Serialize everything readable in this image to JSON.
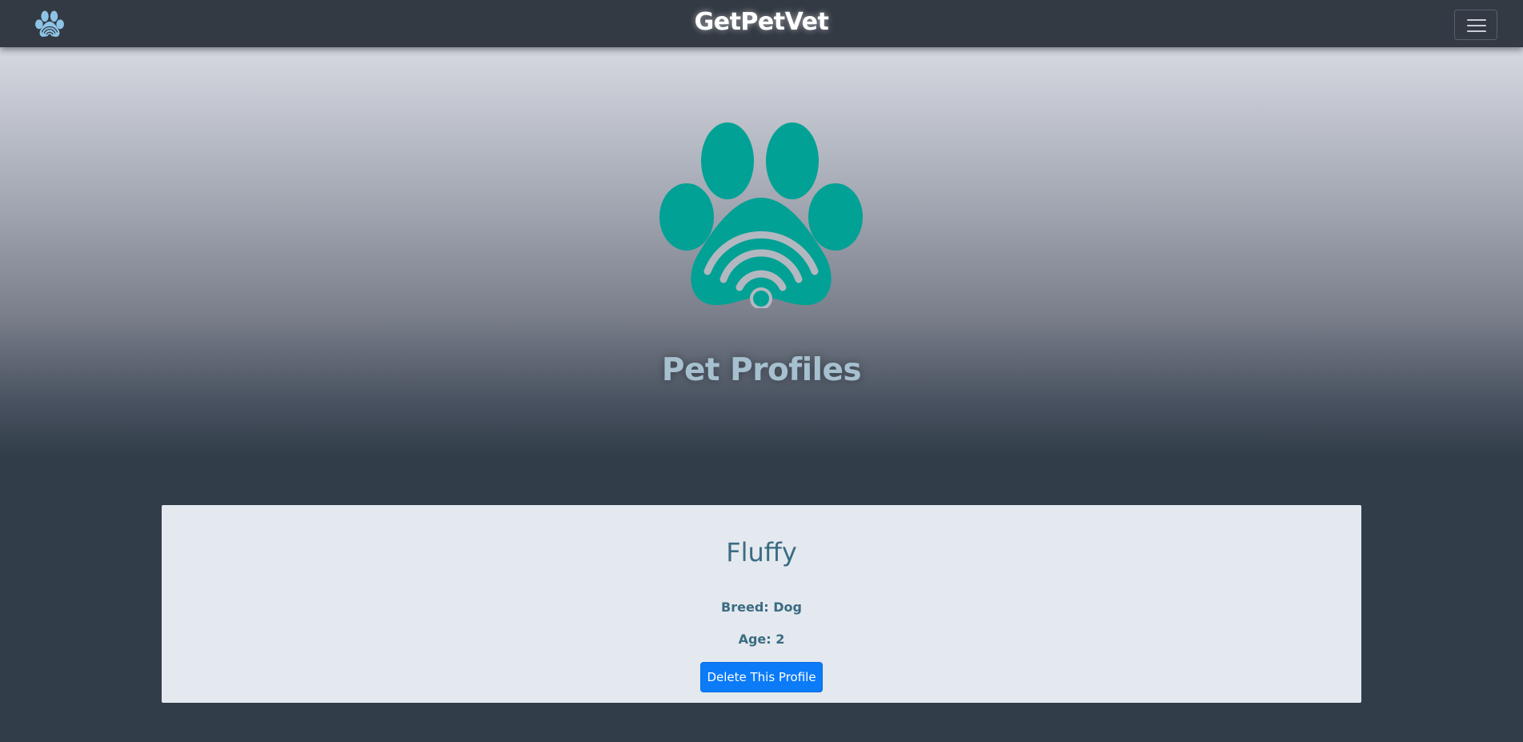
{
  "navbar": {
    "brand": "GetPetVet",
    "logo_icon": "paw-wifi-icon",
    "menu_icon": "hamburger-menu-icon"
  },
  "hero": {
    "logo_icon": "paw-wifi-icon",
    "title": "Pet Profiles"
  },
  "profile": {
    "name": "Fluffy",
    "breed": "Breed: Dog",
    "age": "Age: 2",
    "delete_label": "Delete This Profile"
  },
  "colors": {
    "navbar_bg": "#343a44",
    "accent_teal": "#02a195",
    "nav_logo_blue": "#8dc3e6",
    "hero_title": "#a6c0cf",
    "card_bg": "#e4e8ef",
    "card_text": "#3a6c82",
    "button_primary": "#0b7bf8",
    "page_bottom_bg": "#323d4a"
  }
}
